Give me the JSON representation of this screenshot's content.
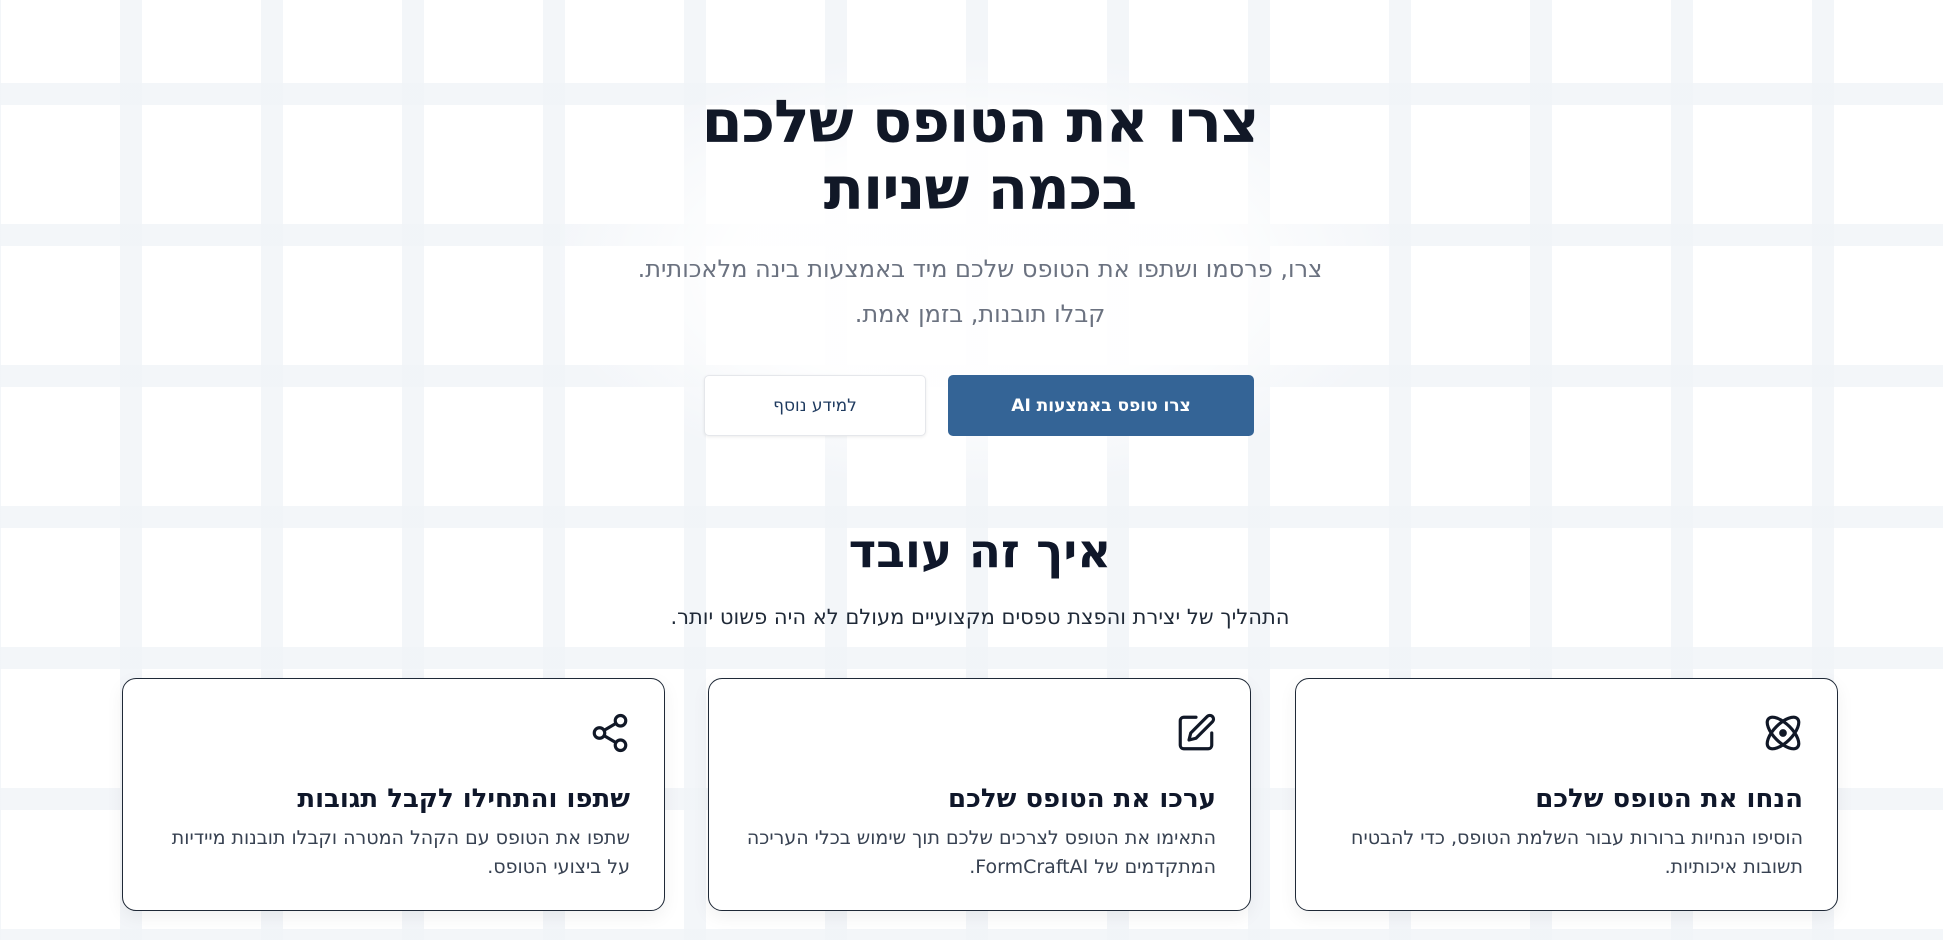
{
  "hero": {
    "title_line1": "צרו את הטופס שלכם",
    "title_line2": "בכמה שניות",
    "subtitle_line1": "צרו, פרסמו ושתפו את הטופס שלכם מיד באמצעות בינה מלאכותית.",
    "subtitle_line2": "קבלו תובנות, בזמן אמת.",
    "primary_button": "צרו טופס באמצעות AI",
    "secondary_button": "למידע נוסף"
  },
  "how_it_works": {
    "title": "איך זה עובד",
    "subtitle": "התהליך של יצירת והפצת טפסים מקצועיים מעולם לא היה פשוט יותר.",
    "cards": [
      {
        "icon": "atom-icon",
        "title": "הנחו את הטופס שלכם",
        "text": "הוסיפו הנחיות ברורות עבור השלמת הטופס, כדי להבטיח תשובות איכותיות."
      },
      {
        "icon": "edit-icon",
        "title": "ערכו את הטופס שלכם",
        "text": "התאימו את הטופס לצרכים שלכם תוך שימוש בכלי העריכה המתקדמים של FormCraftAI."
      },
      {
        "icon": "share-icon",
        "title": "שתפו והתחילו לקבל תגובות",
        "text": "שתפו את הטופס עם הקהל המטרה וקבלו תובנות מיידיות על ביצועי הטופס."
      }
    ]
  },
  "colors": {
    "primary": "#346496",
    "heading": "#111827",
    "muted": "#6b7280"
  }
}
